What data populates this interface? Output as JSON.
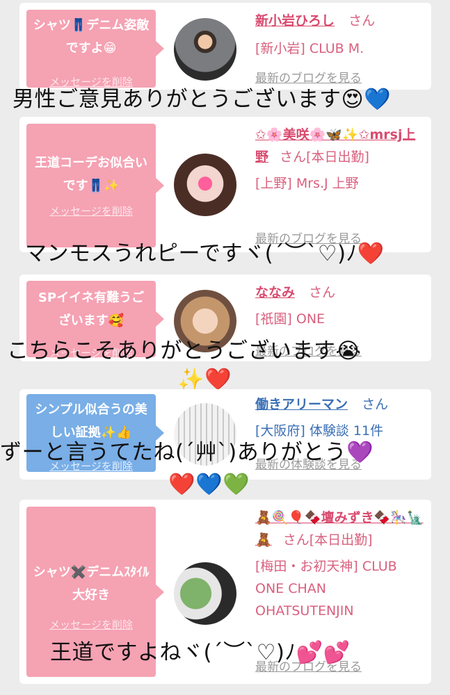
{
  "cards": [
    {
      "message": "シャツ👖デニム姿敵ですよ😁",
      "delete_label": "メッセージを削除",
      "name": "新小岩ひろし",
      "honorific": "さん",
      "shop": "[新小岩] CLUB M.",
      "link": "最新のブログを見る",
      "overlay": "男性ご意見ありがとうございます😍💙"
    },
    {
      "message": "王道コーデお似合いです👖✨",
      "delete_label": "メッセージを削除",
      "name": "✩🌸美咲🌸🦋✨✩mrsj上野",
      "honorific": "さん[本日出勤]",
      "shop": "[上野] Mrs.J 上野",
      "link": "最新のブログを見る",
      "overlay": "マンモスうれピーですヾ(´︶`♡)ﾉ❤️"
    },
    {
      "message": "SPイイネ有難うございます🥰",
      "delete_label": "メッセージを削除",
      "name": "ななみ",
      "honorific": "さん",
      "shop": "[祇園] ONE",
      "link": "最新のブログを見る",
      "overlay_line1": "こちらこそありがとうございます😭",
      "overlay_line2": "✨❤️"
    },
    {
      "message": "シンプル似合うの美しい証拠✨👍",
      "delete_label": "メッセージを削除",
      "name": "働きアリーマン",
      "honorific": "さん",
      "shop": "[大阪府] 体験談 11件",
      "link": "最新の体験談を見る",
      "overlay_line1": "ずーと言うてたね(´艸`)ありがとう💜",
      "overlay_line2": "❤️💙💚"
    },
    {
      "message": "シャツ✖️デニムｽﾀｲﾙ大好き",
      "delete_label": "メッセージを削除",
      "name": "🧸🍭🎈🍫壇みずき🍫🎠🗽🧸",
      "honorific": "さん[本日出勤]",
      "shop": "[梅田・お初天神] CLUB ONE CHAN OHATSUTENJIN",
      "link": "最新のブログを見る",
      "overlay": "王道ですよねヾ(´︶`♡)ﾉ💕💕"
    }
  ],
  "colors": {
    "pink_bubble": "#f5a2b3",
    "blue_bubble": "#79aee6",
    "pink_text": "#d94a6e",
    "blue_text": "#3a6fb5"
  }
}
